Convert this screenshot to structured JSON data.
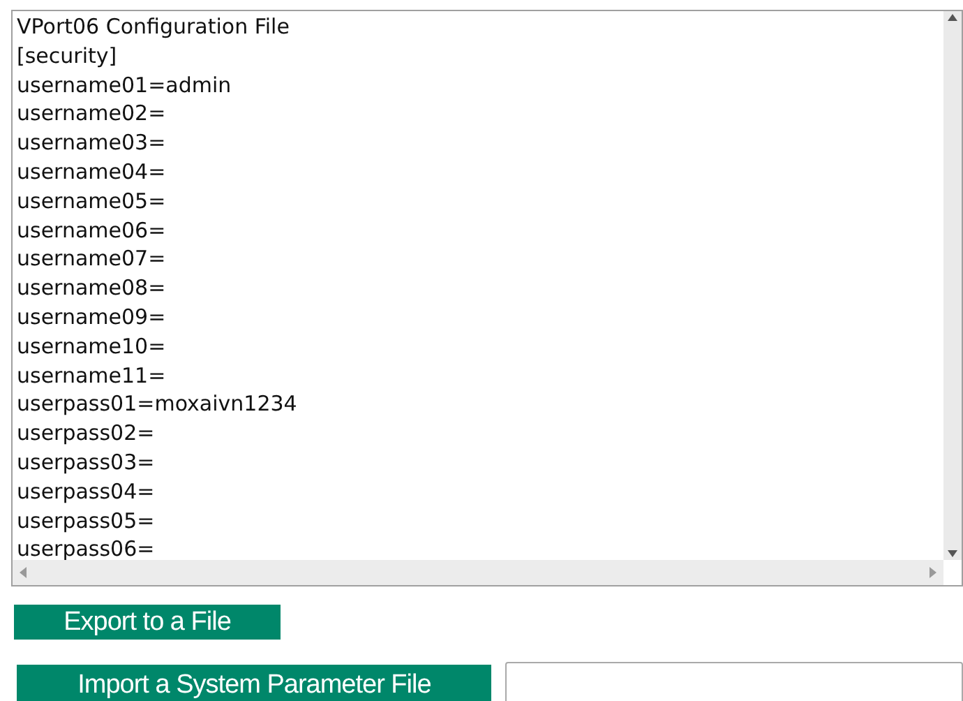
{
  "config_text": {
    "lines": [
      "VPort06 Configuration File",
      "[security]",
      "username01=admin",
      "username02=",
      "username03=",
      "username04=",
      "username05=",
      "username06=",
      "username07=",
      "username08=",
      "username09=",
      "username10=",
      "username11=",
      "userpass01=moxaivn1234",
      "userpass02=",
      "userpass03=",
      "userpass04=",
      "userpass05=",
      "userpass06="
    ]
  },
  "export_button": {
    "label": "Export to a File"
  },
  "import_button": {
    "label": "Import a System Parameter File"
  }
}
